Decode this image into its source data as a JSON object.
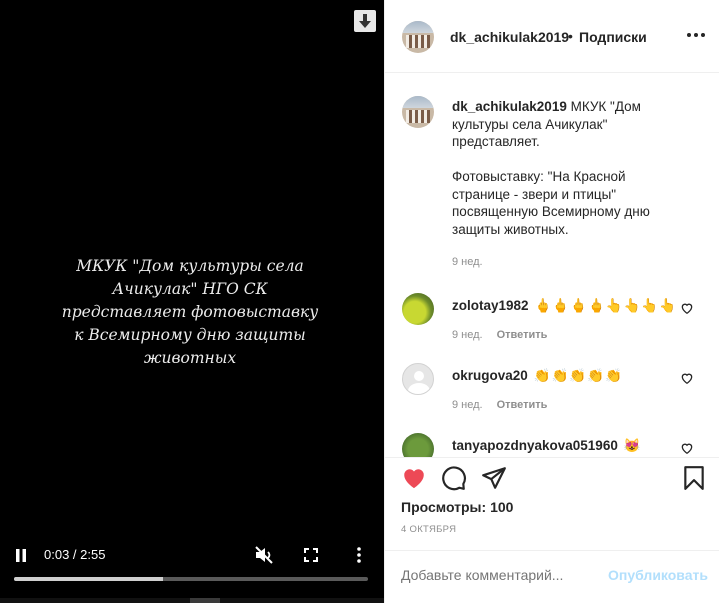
{
  "video": {
    "caption": "МКУК \"Дом культуры села\nАчикулак\" НГО СК\nпредставляет фотовыставку\nк Всемирному дню защиты животных",
    "time_current": "0:03",
    "time_separator": " / ",
    "time_total": "2:55",
    "progress_fraction": 0.42,
    "icons": [
      "download-icon",
      "pause-icon",
      "muted-icon",
      "fullscreen-icon",
      "more-vertical-icon"
    ]
  },
  "header": {
    "username": "dk_achikulak2019",
    "dot": "•",
    "follow_label": "Подписки"
  },
  "description": {
    "username": "dk_achikulak2019",
    "text": " МКУК \"Дом культуры села Ачикулак\" представляет.\n\nФотовыставку: \"На Красной странице - звери и птицы\" посвященную Всемирному дню защиты животных.",
    "age": "9 нед."
  },
  "comments": [
    {
      "user": "zolotay1982",
      "emoji": "🖕🖕🖕🖕👆👆👆👆",
      "age": "9 нед.",
      "reply": "Ответить"
    },
    {
      "user": "okrugova20",
      "emoji": "👏👏👏👏👏",
      "age": "9 нед.",
      "reply": "Ответить"
    },
    {
      "user": "tanyapozdnyakova051960",
      "emoji": "😻",
      "age": "",
      "reply": ""
    }
  ],
  "actions": {
    "views_label": "Просмотры:",
    "views_count": "100",
    "date": "4 ОКТЯБРЯ"
  },
  "add_comment": {
    "placeholder": "Добавьте комментарий...",
    "publish_label": "Опубликовать"
  },
  "colors": {
    "like_red": "#ed4956",
    "publish_disabled": "#b2dffc",
    "secondary_text": "#8e8e8e"
  }
}
